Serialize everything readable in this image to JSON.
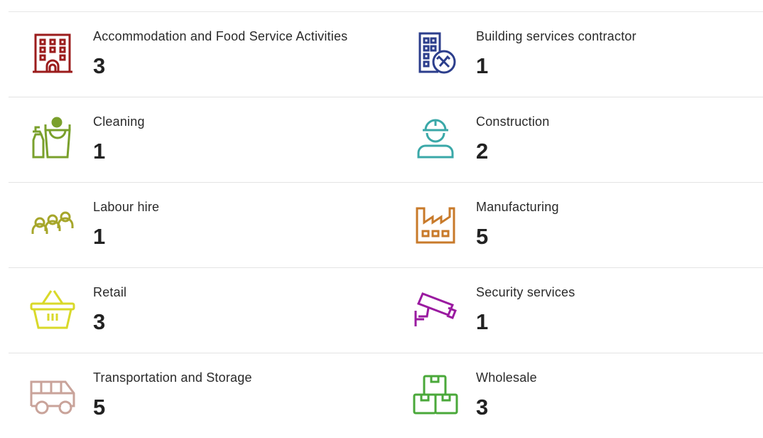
{
  "industries": [
    {
      "label": "Accommodation and Food Service Activities",
      "count": "3",
      "icon": "hotel-icon",
      "color": "#9b1c1c"
    },
    {
      "label": "Building services contractor",
      "count": "1",
      "icon": "building-tools-icon",
      "color": "#2c3e8c"
    },
    {
      "label": "Cleaning",
      "count": "1",
      "icon": "cleaning-supplies-icon",
      "color": "#7aa02c"
    },
    {
      "label": "Construction",
      "count": "2",
      "icon": "construction-worker-icon",
      "color": "#3aa8a8"
    },
    {
      "label": "Labour hire",
      "count": "1",
      "icon": "people-group-icon",
      "color": "#a6a62a"
    },
    {
      "label": "Manufacturing",
      "count": "5",
      "icon": "factory-icon",
      "color": "#c87a2a"
    },
    {
      "label": "Retail",
      "count": "3",
      "icon": "shopping-basket-icon",
      "color": "#d9d92a"
    },
    {
      "label": "Security services",
      "count": "1",
      "icon": "security-camera-icon",
      "color": "#9a1aa0"
    },
    {
      "label": "Transportation and Storage",
      "count": "5",
      "icon": "van-icon",
      "color": "#c9a39a"
    },
    {
      "label": "Wholesale",
      "count": "3",
      "icon": "boxes-icon",
      "color": "#4aa83a"
    }
  ]
}
